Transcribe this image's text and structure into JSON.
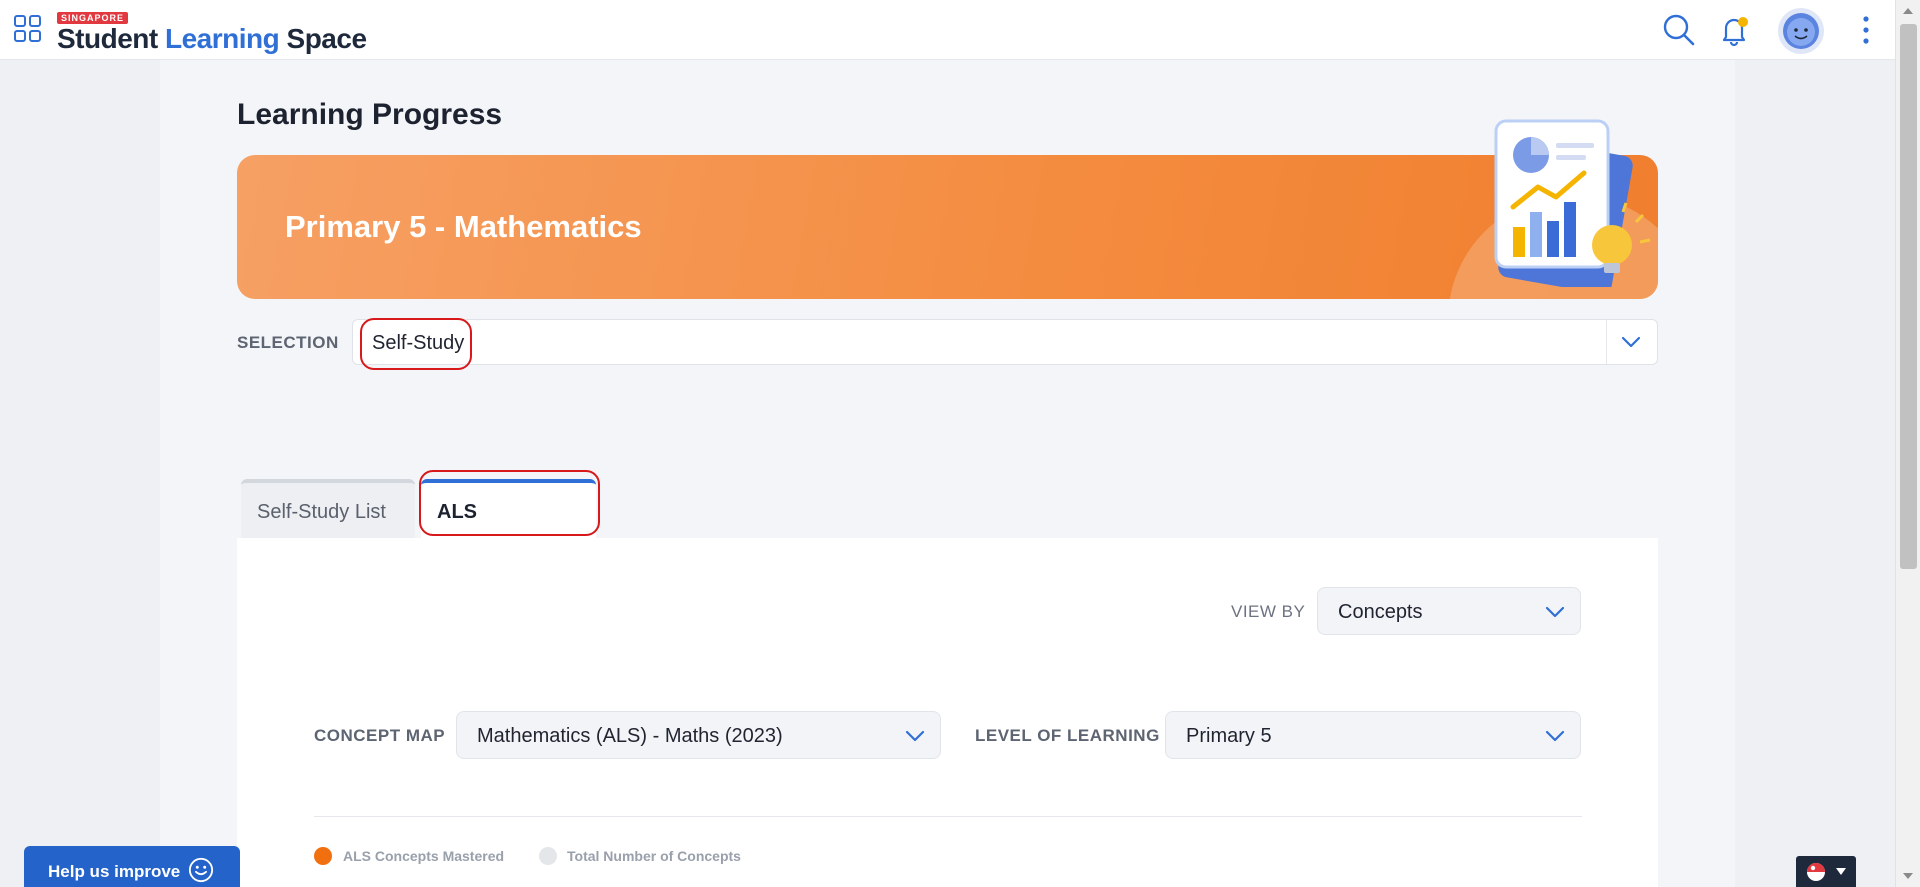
{
  "header": {
    "logo_tag": "SINGAPORE",
    "logo_word1": "Student",
    "logo_word2": "Learning",
    "logo_word3": "Space"
  },
  "page": {
    "title": "Learning Progress",
    "banner_title": "Primary 5 - Mathematics"
  },
  "selection": {
    "label": "SELECTION",
    "value": "Self-Study"
  },
  "tabs": [
    {
      "label": "Self-Study List",
      "active": false
    },
    {
      "label": "ALS",
      "active": true
    }
  ],
  "view_by": {
    "label": "VIEW BY",
    "value": "Concepts"
  },
  "concept_map": {
    "label": "CONCEPT MAP",
    "value": "Mathematics (ALS) - Maths (2023)"
  },
  "level_of_learning": {
    "label": "LEVEL OF LEARNING",
    "value": "Primary 5"
  },
  "legend": [
    {
      "label": "ALS Concepts Mastered",
      "color": "#f26f0f"
    },
    {
      "label": "Total Number of Concepts",
      "color": "#e4e6ea"
    }
  ],
  "footer": {
    "help_label": "Help us improve"
  },
  "colors": {
    "accent": "#2f6fd6",
    "banner": "#f48b3e",
    "annotation": "#d7191c"
  },
  "icons": [
    "apps-grid-icon",
    "search-icon",
    "bell-icon",
    "avatar",
    "more-vertical-icon",
    "chevron-down-icon",
    "smile-icon",
    "language-flag-icon"
  ]
}
